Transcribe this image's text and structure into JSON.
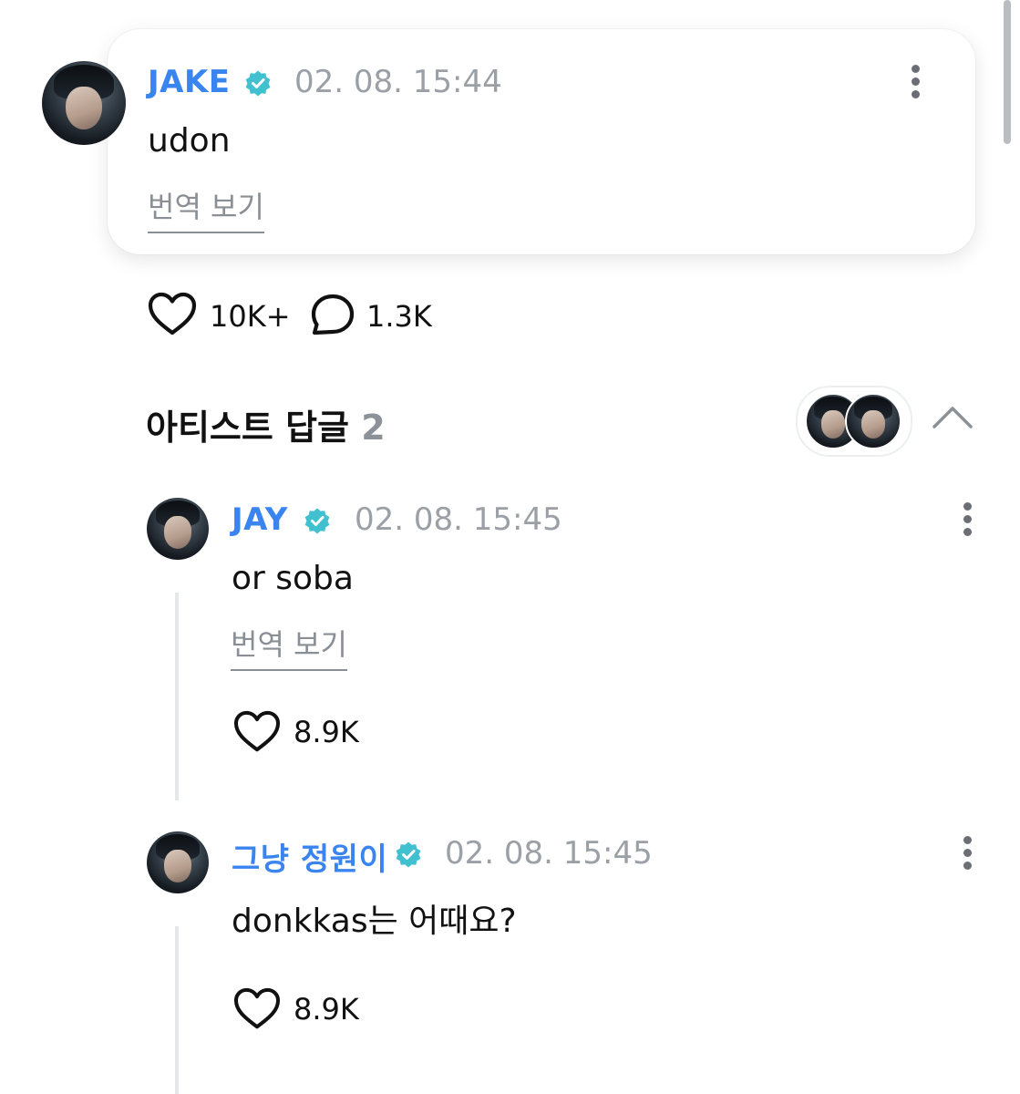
{
  "post": {
    "author": "JAKE",
    "timestamp": "02. 08. 15:44",
    "text": "udon",
    "translate_label": "번역 보기",
    "likes": "10K+",
    "comments": "1.3K"
  },
  "artist_replies": {
    "title": "아티스트 답글",
    "count": "2"
  },
  "replies": [
    {
      "author": "JAY",
      "timestamp": "02. 08. 15:45",
      "text": "or soba",
      "translate_label": "번역 보기",
      "likes": "8.9K"
    },
    {
      "author": "그냥 정원이",
      "timestamp": "02. 08. 15:45",
      "text": "donkkas는 어때요?",
      "likes": "8.9K"
    }
  ],
  "colors": {
    "name_blue": "#3a84f0",
    "badge_teal": "#41c1cf",
    "muted_gray": "#9aa0a6"
  },
  "icons": [
    "heart-icon",
    "comment-bubble-icon",
    "verified-badge-icon",
    "more-vertical-icon",
    "chevron-up-icon"
  ]
}
